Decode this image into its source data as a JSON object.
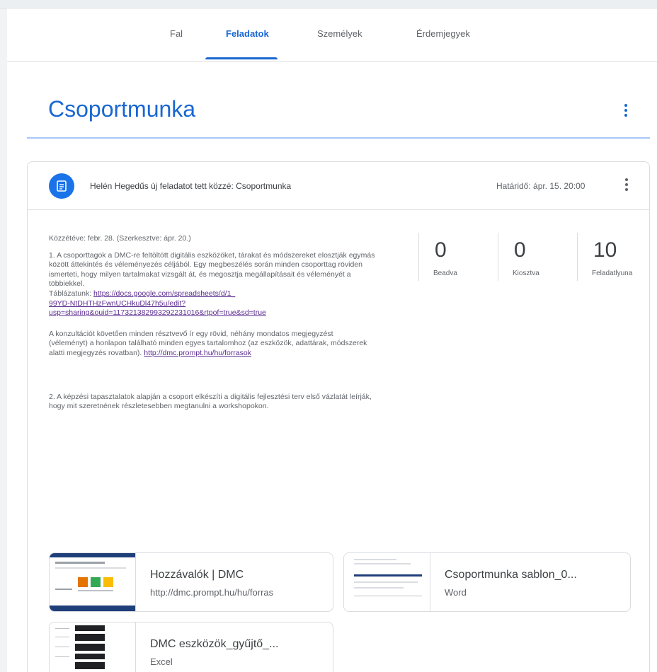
{
  "tabs": [
    {
      "label": "Fal"
    },
    {
      "label": "Feladatok"
    },
    {
      "label": "Személyek"
    },
    {
      "label": "Érdemjegyek"
    }
  ],
  "active_tab": "Feladatok",
  "topic": {
    "title": "Csoportmunka"
  },
  "assignment": {
    "header_text": "Helén Hegedűs új feladatot tett közzé: Csoportmunka",
    "due": "Határidő: ápr. 15. 20:00",
    "posted": "Közzétéve: febr. 28. (Szerkesztve: ápr. 20.)",
    "description": [
      "1. A csoporttagok a DMC-re feltöltött digitális eszközöket, tárakat és módszereket elosztják egymás",
      "között áttekintés és véleményezés céljából. Egy megbeszélés során minden csoporttag röviden",
      "ismerteti, hogy milyen tartalmakat vizsgált át, és megosztja megállapításait és véleményét a",
      "többiekkel.",
      "Táblázatunk:"
    ],
    "link1": "https://docs.google.com/spreadsheets/d/1_99YD-NtDHTHzFwnUCHkuDl47h5u/edit?usp=sharing&ouid=117321382993292231016&rtpof=true&sd=true",
    "link1_display_a": "https://docs.google.com/spreadsheets/d/1_",
    "link1_display_b": "99YD-NtDHTHzFwnUCHkuDl47h5u/edit?",
    "link1_display_c": "usp=sharing&ouid=117321382993292231016&rtpof=true&sd=true",
    "para2": [
      "A konzultációt követően minden résztvevő ír egy rövid, néhány mondatos megjegyzést",
      "(véleményt) a honlapon található minden egyes tartalomhoz (az eszközök, adattárak, módszerek",
      "alatti megjegyzés rovatban)."
    ],
    "link2": "http://dmc.prompt.hu/hu/forrasok",
    "para3": [
      "2. A képzési tapasztalatok alapján a csoport elkészíti a digitális fejlesztési terv első vázlatát leírják,",
      "hogy mit szeretnének részletesebben megtanulni a workshopokon."
    ]
  },
  "stats": [
    {
      "value": "0",
      "label": "Beadva"
    },
    {
      "value": "0",
      "label": "Kiosztva"
    },
    {
      "value": "10",
      "label": "Feladatlyuna"
    }
  ],
  "attachments": [
    {
      "title": "Hozzávalók | DMC",
      "subtitle": "http://dmc.prompt.hu/hu/forras"
    },
    {
      "title": "Csoportmunka sablon_0...",
      "subtitle": "Word"
    },
    {
      "title": "DMC eszközök_gyűjtő_...",
      "subtitle": "Excel"
    }
  ],
  "icons": {
    "assignment": "assignment-icon",
    "more": "more-vert-icon"
  },
  "colors": {
    "accent": "#1967d2",
    "icon_bg": "#1a73e8",
    "link": "#5c2d91"
  }
}
